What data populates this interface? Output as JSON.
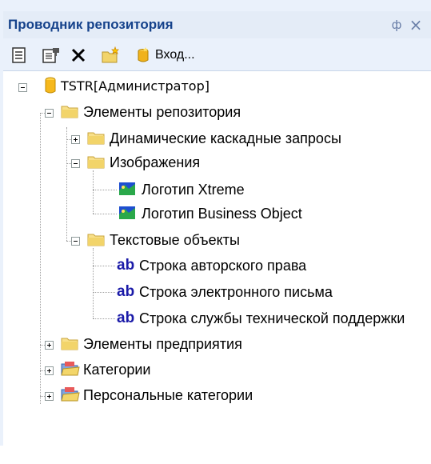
{
  "panel": {
    "title": "Проводник репозитория",
    "pin_glyph": "ф",
    "close_glyph": "×"
  },
  "toolbar": {
    "properties_icon": "properties-icon",
    "edit_icon": "edit-properties-icon",
    "delete_icon": "delete-icon",
    "new_folder_icon": "new-folder-icon",
    "login_icon": "login-icon",
    "login_label": "Вход..."
  },
  "tree": {
    "root": {
      "label": "TSTR[Администратор]",
      "icon": "database-icon"
    },
    "repo_elements": {
      "label": "Элементы репозитория"
    },
    "dynamic_queries": {
      "label": "Динамические каскадные запросы"
    },
    "images": {
      "label": "Изображения"
    },
    "logo_xtreme": {
      "label": "Логотип Xtreme"
    },
    "logo_bo": {
      "label": "Логотип Business Object"
    },
    "text_objects": {
      "label": "Текстовые объекты"
    },
    "copyright": {
      "label": "Строка авторского права",
      "badge": "ab"
    },
    "email": {
      "label": "Строка электронного письма",
      "badge": "ab"
    },
    "support": {
      "label": "Строка службы технической поддержки",
      "badge": "ab"
    },
    "enterprise": {
      "label": "Элементы предприятия"
    },
    "categories": {
      "label": "Категории"
    },
    "personal_categories": {
      "label": "Персональные категории"
    }
  }
}
